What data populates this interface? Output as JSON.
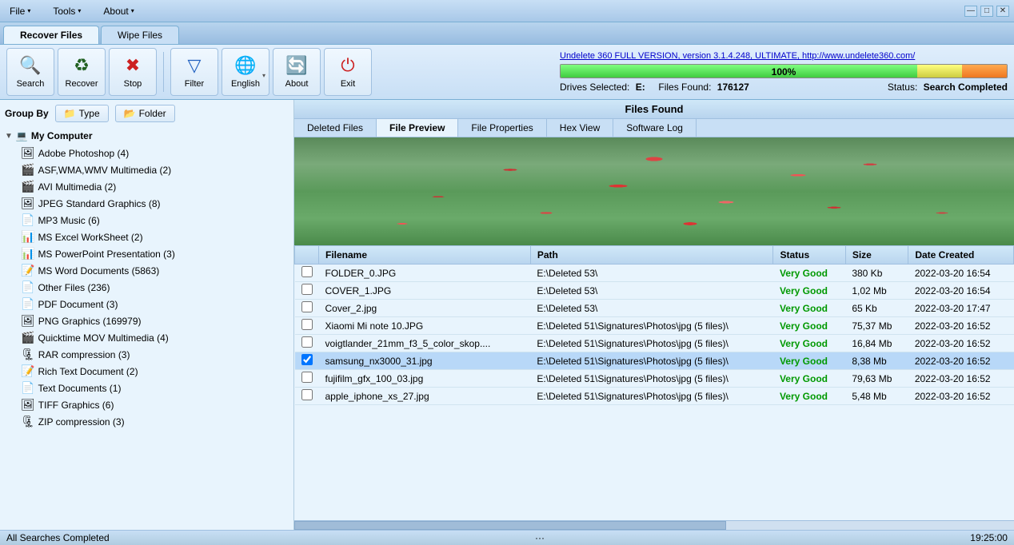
{
  "titlebar": {
    "menus": [
      {
        "label": "File",
        "arrow": true
      },
      {
        "label": "Tools",
        "arrow": true
      },
      {
        "label": "About",
        "arrow": true
      }
    ],
    "win_buttons": [
      "—",
      "□",
      "✕"
    ]
  },
  "tabs": [
    {
      "label": "Recover Files",
      "active": true
    },
    {
      "label": "Wipe Files",
      "active": false
    }
  ],
  "toolbar": {
    "buttons": [
      {
        "label": "Search",
        "icon": "🔍",
        "arrow": false
      },
      {
        "label": "Recover",
        "icon": "♻",
        "arrow": false
      },
      {
        "label": "Stop",
        "icon": "✖",
        "arrow": false
      },
      {
        "label": "Filter",
        "icon": "▽",
        "arrow": false
      },
      {
        "label": "English",
        "icon": "🌐",
        "arrow": true
      },
      {
        "label": "About",
        "icon": "🔄",
        "arrow": false
      },
      {
        "label": "Exit",
        "icon": "⏻",
        "arrow": false
      }
    ]
  },
  "undelete_link": "Undelete 360 FULL VERSION, version 3.1.4.248, ULTIMATE, http://www.undelete360.com/",
  "progress": {
    "percent": "100%",
    "drives_label": "Drives Selected:",
    "drives_value": "E:",
    "files_label": "Files Found:",
    "files_value": "176127",
    "status_label": "Status:",
    "status_value": "Search Completed"
  },
  "group_by": {
    "label": "Group By",
    "type_btn": "Type",
    "folder_btn": "Folder"
  },
  "tree": {
    "root_label": "My Computer",
    "items": [
      {
        "label": "Adobe Photoshop (4)",
        "icon": "🖼"
      },
      {
        "label": "ASF,WMA,WMV Multimedia (2)",
        "icon": "🎬"
      },
      {
        "label": "AVI Multimedia (2)",
        "icon": "🎬"
      },
      {
        "label": "JPEG Standard Graphics (8)",
        "icon": "🖼"
      },
      {
        "label": "MP3 Music (6)",
        "icon": "📄"
      },
      {
        "label": "MS Excel WorkSheet (2)",
        "icon": "📊"
      },
      {
        "label": "MS PowerPoint Presentation (3)",
        "icon": "📊"
      },
      {
        "label": "MS Word Documents (5863)",
        "icon": "📝"
      },
      {
        "label": "Other Files (236)",
        "icon": "📄"
      },
      {
        "label": "PDF Document (3)",
        "icon": "📄"
      },
      {
        "label": "PNG Graphics (169979)",
        "icon": "🖼"
      },
      {
        "label": "Quicktime MOV Multimedia (4)",
        "icon": "🎬"
      },
      {
        "label": "RAR compression (3)",
        "icon": "🗜"
      },
      {
        "label": "Rich Text Document (2)",
        "icon": "📝"
      },
      {
        "label": "Text Documents (1)",
        "icon": "📄"
      },
      {
        "label": "TIFF Graphics (6)",
        "icon": "🖼"
      },
      {
        "label": "ZIP compression (3)",
        "icon": "🗜"
      }
    ]
  },
  "files_found_header": "Files Found",
  "panel_tabs": [
    {
      "label": "Deleted Files",
      "active": false
    },
    {
      "label": "File Preview",
      "active": true
    },
    {
      "label": "File Properties",
      "active": false
    },
    {
      "label": "Hex View",
      "active": false
    },
    {
      "label": "Software Log",
      "active": false
    }
  ],
  "table": {
    "columns": [
      "Filename",
      "Path",
      "Status",
      "Size",
      "Date Created"
    ],
    "rows": [
      {
        "check": false,
        "filename": "FOLDER_0.JPG",
        "path": "E:\\Deleted 53\\",
        "status": "Very Good",
        "size": "380 Kb",
        "date": "2022-03-20 16:54"
      },
      {
        "check": false,
        "filename": "COVER_1.JPG",
        "path": "E:\\Deleted 53\\",
        "status": "Very Good",
        "size": "1,02 Mb",
        "date": "2022-03-20 16:54"
      },
      {
        "check": false,
        "filename": "Cover_2.jpg",
        "path": "E:\\Deleted 53\\",
        "status": "Very Good",
        "size": "65 Kb",
        "date": "2022-03-20 17:47"
      },
      {
        "check": false,
        "filename": "Xiaomi Mi note 10.JPG",
        "path": "E:\\Deleted 51\\Signatures\\Photos\\jpg (5 files)\\",
        "status": "Very Good",
        "size": "75,37 Mb",
        "date": "2022-03-20 16:52"
      },
      {
        "check": false,
        "filename": "voigtlander_21mm_f3_5_color_skop....",
        "path": "E:\\Deleted 51\\Signatures\\Photos\\jpg (5 files)\\",
        "status": "Very Good",
        "size": "16,84 Mb",
        "date": "2022-03-20 16:52"
      },
      {
        "check": true,
        "filename": "samsung_nx3000_31.jpg",
        "path": "E:\\Deleted 51\\Signatures\\Photos\\jpg (5 files)\\",
        "status": "Very Good",
        "size": "8,38 Mb",
        "date": "2022-03-20 16:52"
      },
      {
        "check": false,
        "filename": "fujifilm_gfx_100_03.jpg",
        "path": "E:\\Deleted 51\\Signatures\\Photos\\jpg (5 files)\\",
        "status": "Very Good",
        "size": "79,63 Mb",
        "date": "2022-03-20 16:52"
      },
      {
        "check": false,
        "filename": "apple_iphone_xs_27.jpg",
        "path": "E:\\Deleted 51\\Signatures\\Photos\\jpg (5 files)\\",
        "status": "Very Good",
        "size": "5,48 Mb",
        "date": "2022-03-20 16:52"
      }
    ]
  },
  "statusbar": {
    "left": "All Searches Completed",
    "right": "19:25:00"
  }
}
